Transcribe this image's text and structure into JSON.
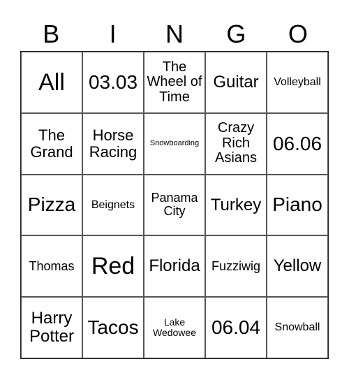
{
  "header": {
    "letters": [
      "B",
      "I",
      "N",
      "G",
      "O"
    ]
  },
  "grid": {
    "rows": [
      [
        "All",
        "03.03",
        "The Wheel of Time",
        "Guitar",
        "Volleyball"
      ],
      [
        "The Grand",
        "Horse Racing",
        "Snowboarding",
        "Crazy Rich Asians",
        "06.06"
      ],
      [
        "Pizza",
        "Beignets",
        "Panama City",
        "Turkey",
        "Piano"
      ],
      [
        "Thomas",
        "Red",
        "Florida",
        "Fuzziwig",
        "Yellow"
      ],
      [
        "Harry Potter",
        "Tacos",
        "Lake Wedowee",
        "06.04",
        "Snowball"
      ]
    ]
  }
}
